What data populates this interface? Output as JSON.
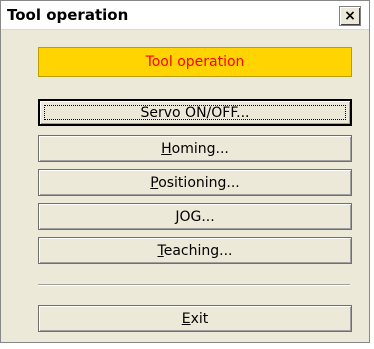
{
  "window": {
    "title": "Tool operation",
    "close_glyph": "×",
    "close_icon": "close-icon"
  },
  "banner": {
    "text": "Tool operation",
    "background": "#ffd400",
    "color": "#ff0000"
  },
  "buttons": [
    {
      "pre": "Servo ON/OFF...",
      "u": "",
      "post": "",
      "focused": true
    },
    {
      "pre": "",
      "u": "H",
      "post": "oming...",
      "focused": false
    },
    {
      "pre": "",
      "u": "P",
      "post": "ositioning...",
      "focused": false
    },
    {
      "pre": "",
      "u": "J",
      "post": "OG...",
      "focused": false
    },
    {
      "pre": "",
      "u": "T",
      "post": "eaching...",
      "focused": false
    }
  ],
  "exit": {
    "pre": "",
    "u": "E",
    "post": "xit"
  }
}
